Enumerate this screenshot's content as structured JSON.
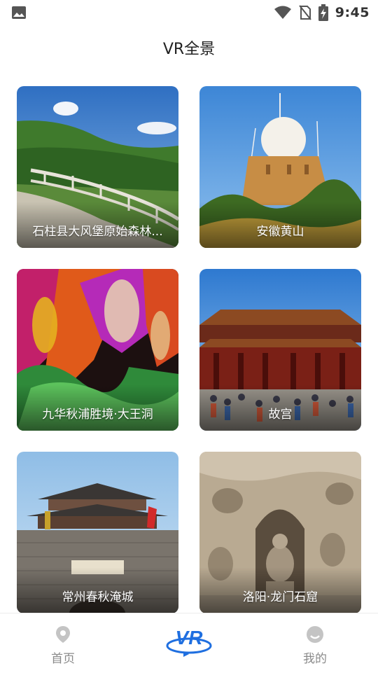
{
  "status_bar": {
    "time": "9:45",
    "icons": [
      "image-icon",
      "wifi-icon",
      "no-sim-icon",
      "battery-charging-icon"
    ]
  },
  "page": {
    "title": "VR全景"
  },
  "cards": [
    {
      "label": "石柱县大风堡原始森林..."
    },
    {
      "label": "安徽黄山"
    },
    {
      "label": "九华秋浦胜境·大王洞"
    },
    {
      "label": "故宫"
    },
    {
      "label": "常州春秋淹城"
    },
    {
      "label": "洛阳·龙门石窟"
    }
  ],
  "tabbar": {
    "home_label": "首页",
    "vr_label": "VR",
    "mine_label": "我的",
    "icons": [
      "location-pin-icon",
      "vr-logo-icon",
      "profile-face-icon"
    ],
    "active": "vr",
    "colors": {
      "inactive": "#c4c4c4",
      "vr_blue": "#1f6fe0"
    }
  }
}
